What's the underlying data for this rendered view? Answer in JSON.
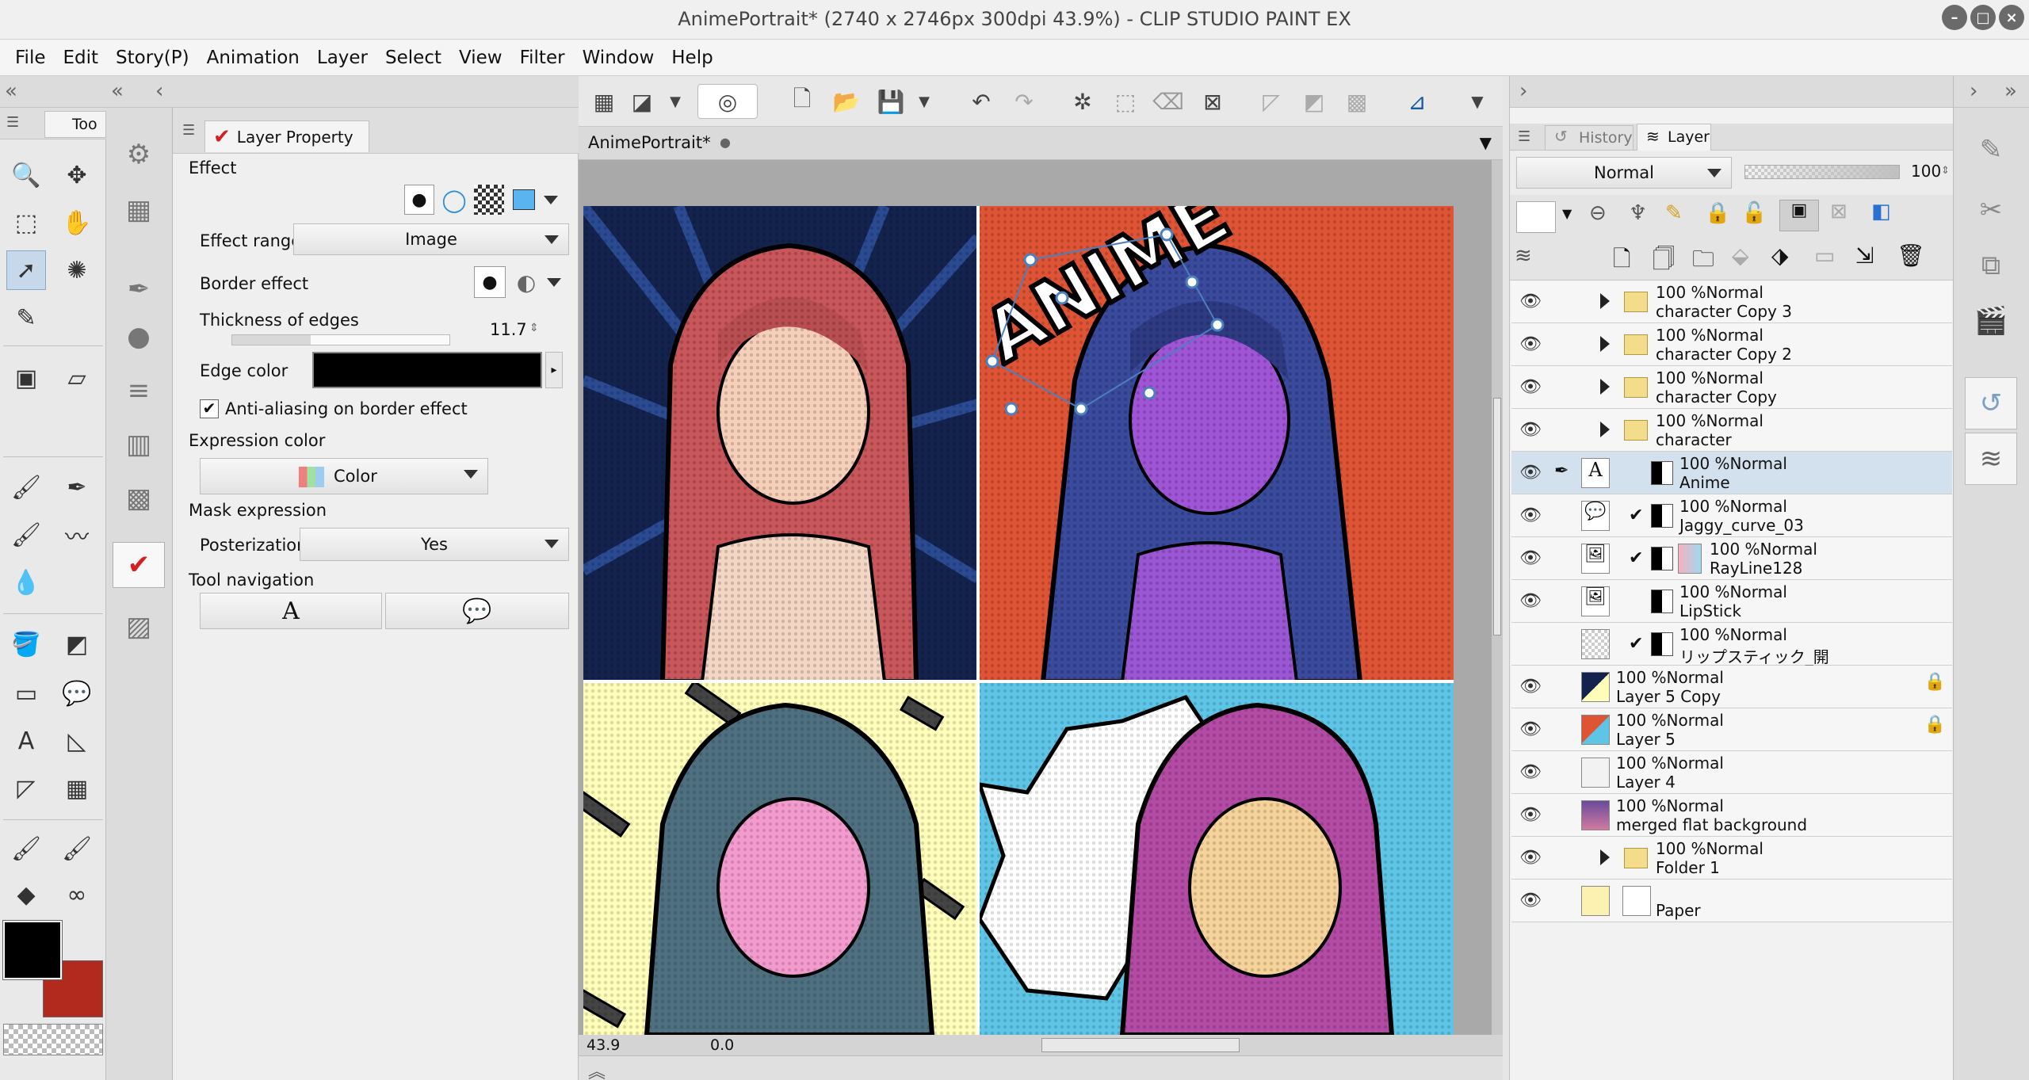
{
  "window": {
    "title": "AnimePortrait* (2740 x 2746px 300dpi 43.9%)  - CLIP STUDIO PAINT EX"
  },
  "menu": [
    "File",
    "Edit",
    "Story(P)",
    "Animation",
    "Layer",
    "Select",
    "View",
    "Filter",
    "Window",
    "Help"
  ],
  "tool_panel": {
    "tab_label": "Too"
  },
  "layer_property": {
    "tab_label": "Layer Property",
    "effect_label": "Effect",
    "effect_range_label": "Effect range",
    "effect_range_value": "Image",
    "border_effect_label": "Border effect",
    "thickness_label": "Thickness of edges",
    "thickness_value": "11.7",
    "edge_color_label": "Edge color",
    "antialias_label": "Anti-aliasing on border effect",
    "antialias_checked": true,
    "expression_color_label": "Expression color",
    "expression_color_value": "Color",
    "mask_expression_label": "Mask expression",
    "posterization_label": "Posterization",
    "posterization_value": "Yes",
    "tool_navigation_label": "Tool navigation"
  },
  "document": {
    "tab": "AnimePortrait*",
    "zoom": "43.9",
    "rotation": "0.0"
  },
  "artwork": {
    "text": "ANIME"
  },
  "layer_panel": {
    "tabs": [
      "History",
      "Layer"
    ],
    "blend_mode": "Normal",
    "opacity": "100",
    "layers": [
      {
        "mode": "100 %Normal",
        "name": "character Copy 3",
        "type": "folder"
      },
      {
        "mode": "100 %Normal",
        "name": "character Copy 2",
        "type": "folder"
      },
      {
        "mode": "100 %Normal",
        "name": "character Copy",
        "type": "folder"
      },
      {
        "mode": "100 %Normal",
        "name": "character",
        "type": "folder"
      },
      {
        "mode": "100 %Normal",
        "name": "Anime",
        "type": "text",
        "selected": true
      },
      {
        "mode": "100 %Normal",
        "name": "Jaggy_curve_03",
        "type": "balloon"
      },
      {
        "mode": "100 %Normal",
        "name": "RayLine128",
        "type": "image"
      },
      {
        "mode": "100 %Normal",
        "name": "LipStick",
        "type": "image"
      },
      {
        "mode": "100 %Normal",
        "name": "リップスティック_開",
        "type": "image"
      },
      {
        "mode": "100 %Normal",
        "name": "Layer 5 Copy",
        "type": "raster"
      },
      {
        "mode": "100 %Normal",
        "name": "Layer 5",
        "type": "raster"
      },
      {
        "mode": "100 %Normal",
        "name": "Layer 4",
        "type": "raster"
      },
      {
        "mode": "100 %Normal",
        "name": "merged flat background",
        "type": "raster"
      },
      {
        "mode": "100 %Normal",
        "name": "Folder 1",
        "type": "folder"
      },
      {
        "mode": "",
        "name": "Paper",
        "type": "paper"
      }
    ]
  },
  "colors": {
    "main": "#000000",
    "sub": "#b22a1e",
    "selection": "#d3e1ee",
    "accent": "#4a7fc0"
  }
}
